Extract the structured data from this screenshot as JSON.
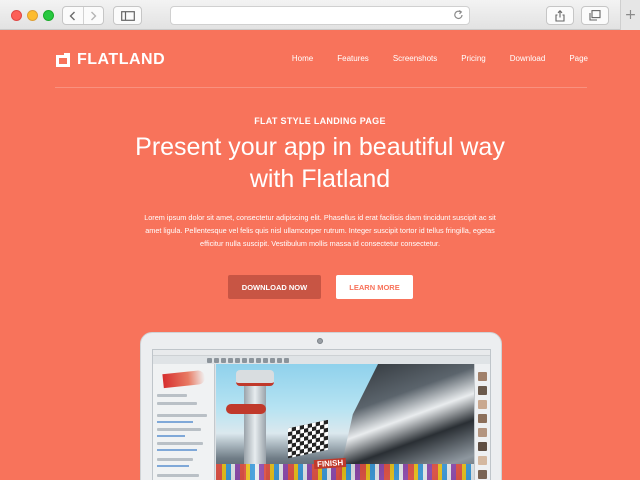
{
  "browser": {
    "url": "",
    "new_tab_label": "+"
  },
  "site": {
    "logo_text": "FLATLAND",
    "nav": [
      "Home",
      "Features",
      "Screenshots",
      "Pricing",
      "Download",
      "Page"
    ]
  },
  "hero": {
    "eyebrow": "FLAT STYLE LANDING PAGE",
    "headline_line1": "Present your app in beautiful way",
    "headline_line2": "with Flatland",
    "lead_line1": "Lorem ipsum dolor sit amet, consectetur adipiscing elit. Phasellus id erat facilisis diam tincidunt suscipit ac sit",
    "lead_line2": "amet ligula. Pellentesque vel felis quis nisl ullamcorper rutrum. Integer suscipit tortor id tellus fringilla, egetas",
    "lead_line3": "efficitur nulla suscipit. Vestibulum mollis massa id consectetur consectetur.",
    "download_label": "DOWNLOAD NOW",
    "learn_label": "LEARN MORE"
  },
  "mockup": {
    "finish_text": "FINISH"
  },
  "colors": {
    "page_bg": "#f8735b",
    "download_bg": "#c85544",
    "learn_bg": "#ffffff"
  }
}
